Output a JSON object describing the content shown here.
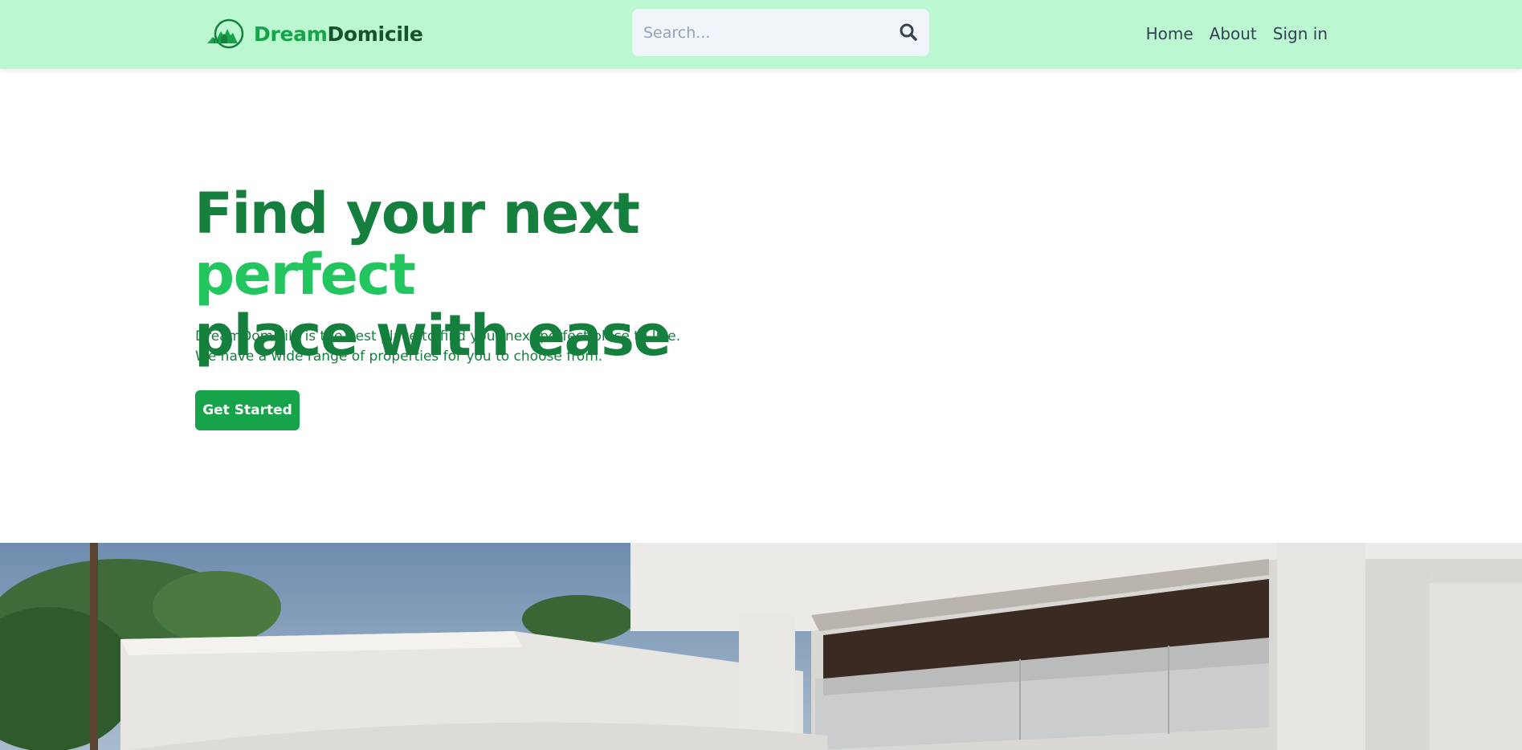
{
  "brand": {
    "name_part1": "Dream",
    "name_part2": "Domicile",
    "logo_icon": "house-mountain-logo-icon"
  },
  "search": {
    "placeholder": "Search...",
    "icon": "search-icon"
  },
  "nav": {
    "items": [
      "Home",
      "About",
      "Sign in"
    ]
  },
  "hero": {
    "title_line1_part1": "Find your next ",
    "title_line1_accent": "perfect",
    "title_line2": "place with ease",
    "description_line1": "DreamDomicile is the best place to find your next perfect place to live.",
    "description_line2": "We have a wide range of properties for you to choose from.",
    "cta_label": "Get Started"
  },
  "colors": {
    "header_bg": "#bbf7d0",
    "primary_green": "#15803d",
    "accent_green": "#22c55e",
    "button_green": "#16a34a",
    "logo_dark": "#14532d"
  },
  "images": {
    "hero_image": "modern white house photo"
  }
}
